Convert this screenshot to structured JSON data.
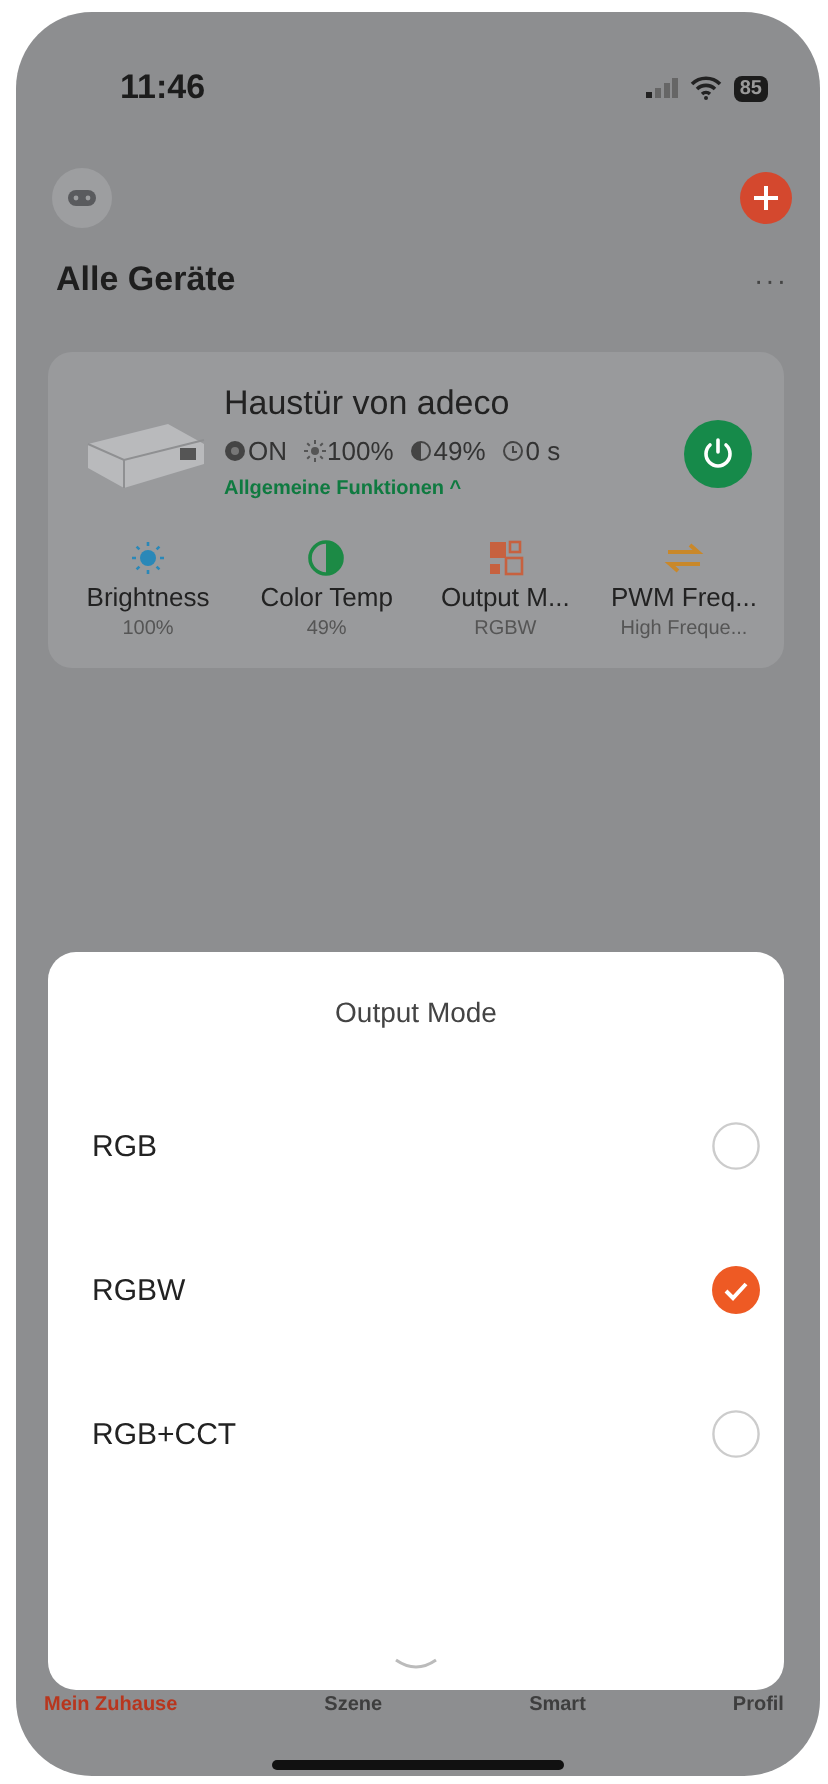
{
  "status_bar": {
    "time": "11:46",
    "battery": "85"
  },
  "header": {
    "title": "Alle Geräte",
    "more": "···"
  },
  "device": {
    "name": "Haustür von adeco",
    "on": true,
    "status": [
      {
        "kind": "power",
        "text": "ON"
      },
      {
        "kind": "brightness",
        "text": "100%"
      },
      {
        "kind": "temp",
        "text": "49%"
      },
      {
        "kind": "timer",
        "text": "0 s"
      }
    ],
    "functions_link": "Allgemeine Funktionen ^",
    "functions": [
      {
        "kind": "brightness",
        "label": "Brightness",
        "value": "100%"
      },
      {
        "kind": "temp",
        "label": "Color Temp",
        "value": "49%"
      },
      {
        "kind": "mode",
        "label": "Output M...",
        "value": "RGBW"
      },
      {
        "kind": "pwm",
        "label": "PWM Freq...",
        "value": "High Freque..."
      }
    ]
  },
  "sheet": {
    "title": "Output Mode",
    "options": [
      {
        "label": "RGB",
        "selected": false
      },
      {
        "label": "RGBW",
        "selected": true
      },
      {
        "label": "RGB+CCT",
        "selected": false
      }
    ]
  },
  "tabs": [
    {
      "label": "Mein Zuhause",
      "selected": true
    },
    {
      "label": "Szene",
      "selected": false
    },
    {
      "label": "Smart",
      "selected": false
    },
    {
      "label": "Profil",
      "selected": false
    }
  ]
}
